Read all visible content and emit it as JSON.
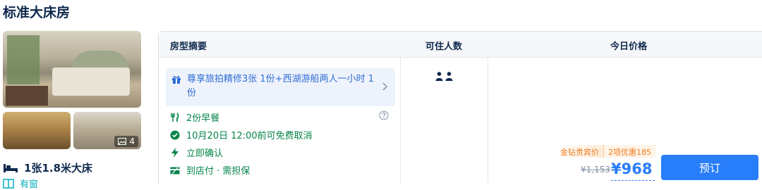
{
  "room": {
    "title": "标准大床房"
  },
  "photos": {
    "count_label": "4"
  },
  "bed": {
    "label": "1张1.8米大床"
  },
  "window": {
    "label": "有窗"
  },
  "table": {
    "headers": {
      "summary": "房型摘要",
      "guests": "可住人数",
      "price": "今日价格"
    }
  },
  "offer": {
    "gift_text": "尊享旅拍精修3张 1份+西湖游船两人一小时 1份",
    "features": [
      {
        "icon": "utensils-icon",
        "text": "2份早餐"
      },
      {
        "icon": "check-circle-icon",
        "text": "10月20日 12:00前可免费取消"
      },
      {
        "icon": "lightning-icon",
        "text": "立即确认"
      },
      {
        "icon": "pay-at-hotel-icon",
        "text": "到店付 · 需担保"
      }
    ],
    "guests_count": 2,
    "promo_tags": [
      "金钻贵宾价",
      "2项优惠185"
    ],
    "original_price": "¥1,153",
    "price": "¥968",
    "book_label": "预订"
  },
  "colors": {
    "accent": "#287dfa",
    "green": "#06844a",
    "promo": "#f07b1c"
  }
}
